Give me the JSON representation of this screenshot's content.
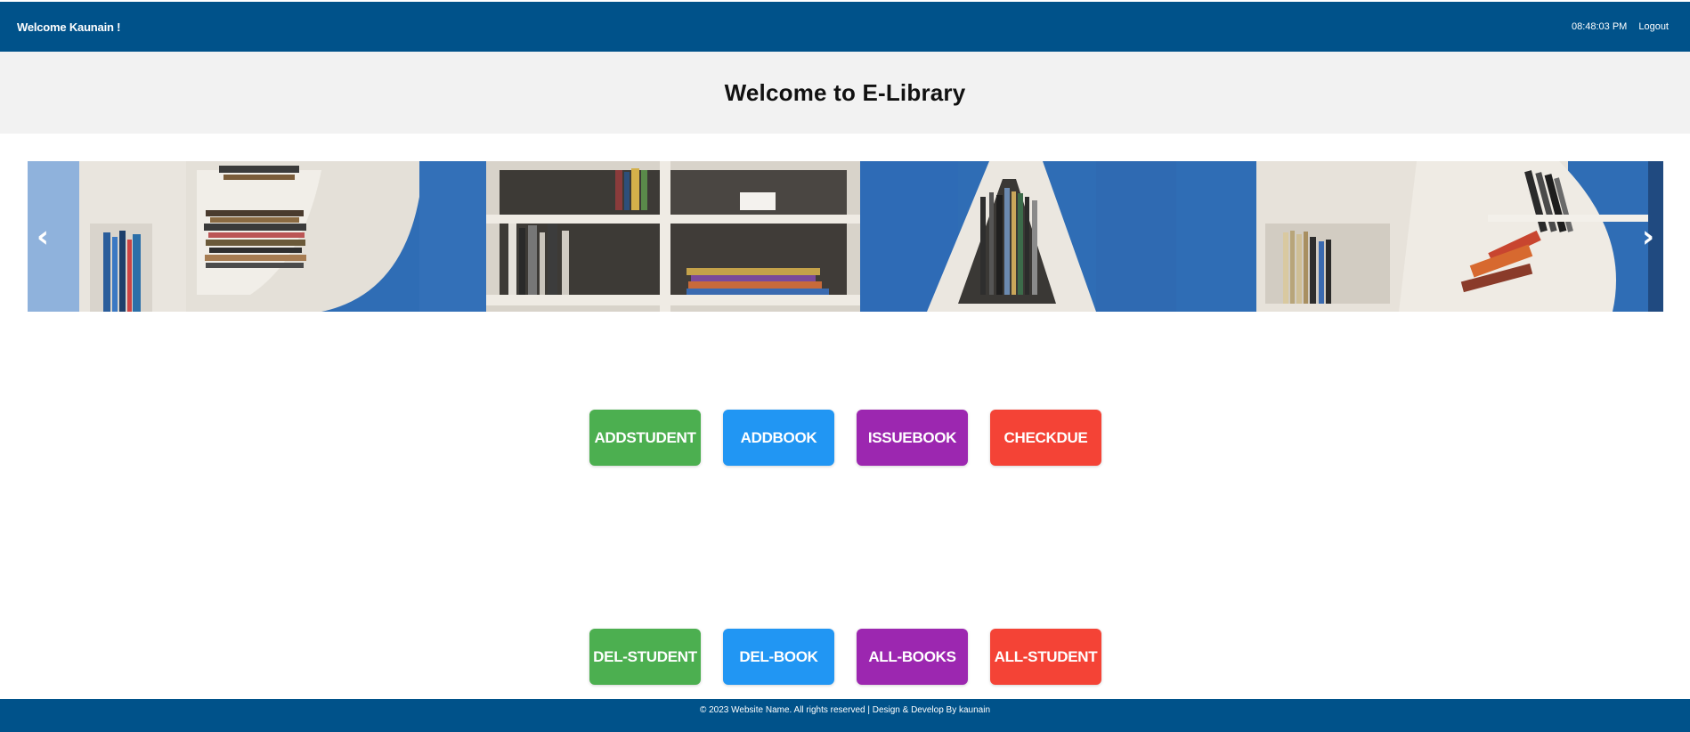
{
  "header": {
    "welcome_text": "Welcome Kaunain !",
    "time": "08:48:03 PM",
    "logout_label": "Logout",
    "bg_color": "#00528a"
  },
  "hero": {
    "title": "Welcome to E-Library"
  },
  "carousel": {
    "prev_icon": "‹",
    "next_icon": "›"
  },
  "actions": {
    "row1": [
      {
        "label": "ADDSTUDENT",
        "color": "#4caf50"
      },
      {
        "label": "ADDBOOK",
        "color": "#2196f3"
      },
      {
        "label": "ISSUEBOOK",
        "color": "#9c27b0"
      },
      {
        "label": "CHECKDUE",
        "color": "#f44336"
      }
    ],
    "row2": [
      {
        "label": "DEL-STUDENT",
        "color": "#4caf50"
      },
      {
        "label": "DEL-BOOK",
        "color": "#2196f3"
      },
      {
        "label": "ALL-BOOKS",
        "color": "#9c27b0"
      },
      {
        "label": "ALL-STUDENT",
        "color": "#f44336"
      }
    ]
  },
  "footer": {
    "text": "© 2023 Website Name. All rights reserved | Design & Develop By kaunain"
  }
}
